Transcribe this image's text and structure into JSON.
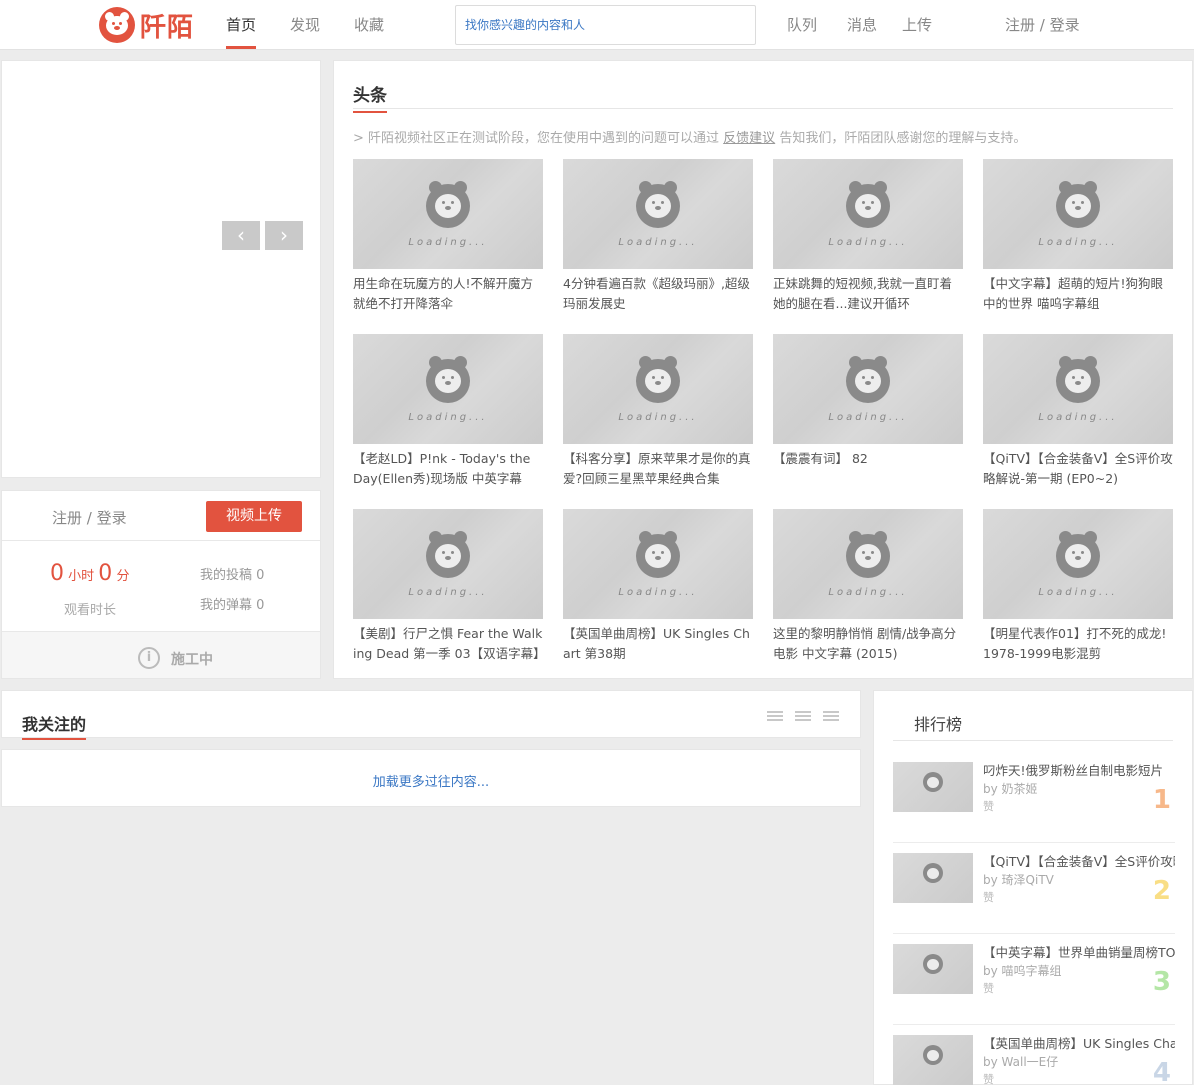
{
  "header": {
    "logo_text": "阡陌",
    "nav": [
      "首页",
      "发现",
      "收藏"
    ],
    "search_placeholder": "找你感兴趣的内容和人",
    "right_nav": [
      "队列",
      "消息",
      "上传"
    ],
    "auth": "注册 / 登录"
  },
  "slider": {
    "prev": "‹",
    "next": "›"
  },
  "user_panel": {
    "login": "注册 / 登录",
    "upload_button": "视频上传",
    "hours": "0",
    "hours_unit": "小时",
    "minutes": "0",
    "minutes_unit": "分",
    "watch_label": "观看时长",
    "posts": "我的投稿 0",
    "danmu": "我的弹幕 0",
    "construction": "施工中"
  },
  "headline": {
    "title": "头条",
    "notice_prefix": "> 阡陌视频社区正在测试阶段，您在使用中遇到的问题可以通过",
    "notice_link": "反馈建议",
    "notice_suffix": "告知我们，阡陌团队感谢您的理解与支持。",
    "loading_text": "Loading...",
    "cards": [
      "用生命在玩魔方的人!不解开魔方就绝不打开降落伞",
      "4分钟看遍百款《超级玛丽》,超级玛丽发展史",
      "正妹跳舞的短视频,我就一直盯着她的腿在看...建议开循环",
      "【中文字幕】超萌的短片!狗狗眼中的世界 喵呜字幕组",
      "【老赵LD】P!nk - Today's the Day(Ellen秀)现场版 中英字幕",
      "【科客分享】原来苹果才是你的真爱?回顾三星黑苹果经典合集",
      "【震震有词】 82",
      "【QiTV】【合金装备V】全S评价攻略解说-第一期 (EP0~2)",
      "【美剧】行尸之惧 Fear the Walking Dead 第一季 03【双语字幕】",
      "【英国单曲周榜】UK Singles Chart 第38期",
      "这里的黎明静悄悄 剧情/战争高分电影 中文字幕 (2015)",
      "【明星代表作01】打不死的成龙!1978-1999电影混剪"
    ]
  },
  "follow": {
    "title": "我关注的",
    "load_more": "加载更多过往内容..."
  },
  "ranking": {
    "title": "排行榜",
    "like_label": "赞",
    "items": [
      {
        "title": "叼炸天!俄罗斯粉丝自制电影短片",
        "by": "by 奶茶姬",
        "rank": "1",
        "color": "#f7b88a"
      },
      {
        "title": "【QiTV】【合金装备V】全S评价攻略解说",
        "by": "by 琦泽QiTV",
        "rank": "2",
        "color": "#f9de85"
      },
      {
        "title": "【中英字幕】世界单曲销量周榜TOP",
        "by": "by 喵呜字幕组",
        "rank": "3",
        "color": "#b4e6a6"
      },
      {
        "title": "【英国单曲周榜】UK Singles Chart",
        "by": "by Wall一E仔",
        "rank": "4",
        "color": "#c9d6e6"
      }
    ]
  }
}
